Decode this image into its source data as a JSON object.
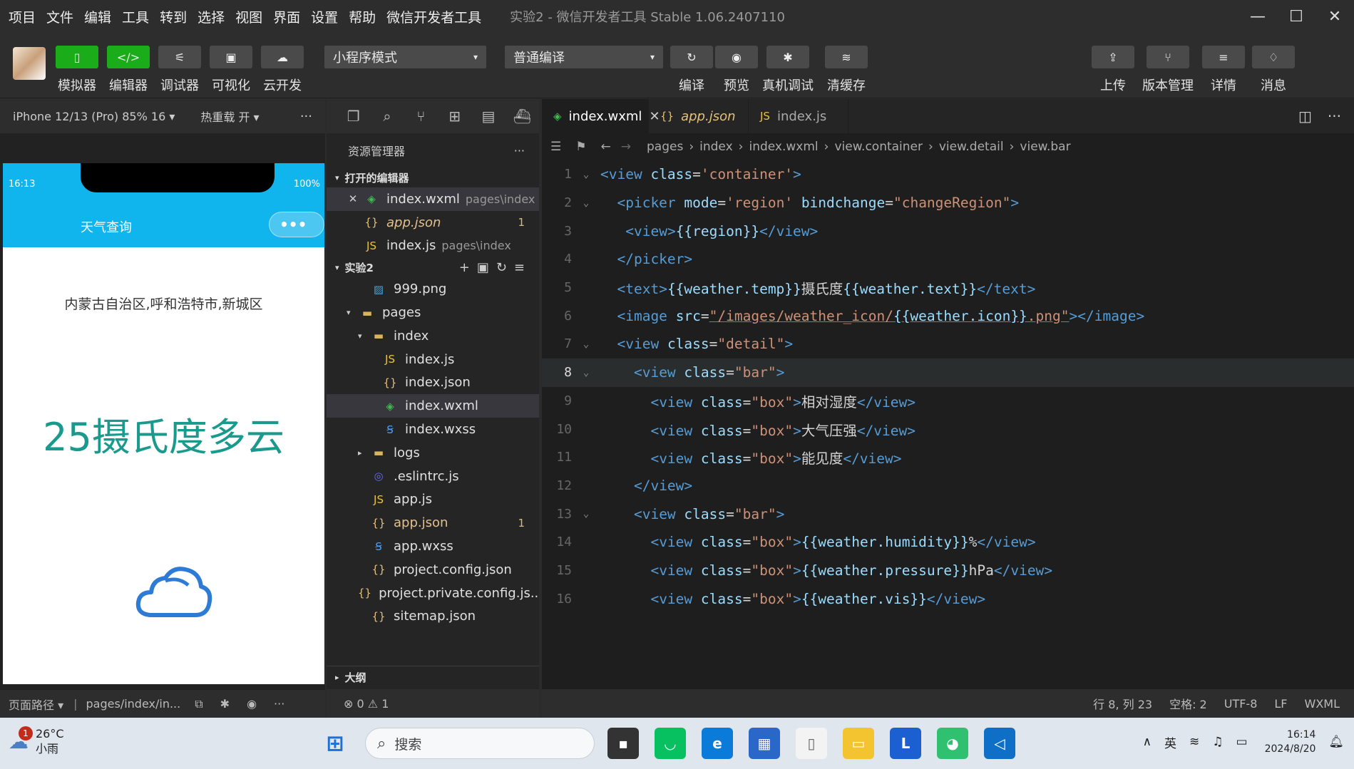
{
  "menu": [
    "项目",
    "文件",
    "编辑",
    "工具",
    "转到",
    "选择",
    "视图",
    "界面",
    "设置",
    "帮助",
    "微信开发者工具"
  ],
  "window_title": "实验2 - 微信开发者工具 Stable 1.06.2407110",
  "toolbar": {
    "left_buttons": [
      {
        "label": "模拟器",
        "icon": "phone-icon",
        "active": true
      },
      {
        "label": "编辑器",
        "icon": "code-icon",
        "active": true
      },
      {
        "label": "调试器",
        "icon": "debug-icon",
        "active": false
      },
      {
        "label": "可视化",
        "icon": "layout-icon",
        "active": false
      },
      {
        "label": "云开发",
        "icon": "cloud-icon",
        "active": false
      }
    ],
    "mode_select": "小程序模式",
    "compile_select": "普通编译",
    "mid_buttons": [
      {
        "label": "编译",
        "icon": "refresh-icon"
      },
      {
        "label": "预览",
        "icon": "eye-icon"
      },
      {
        "label": "真机调试",
        "icon": "bug-icon"
      },
      {
        "label": "清缓存",
        "icon": "layers-icon"
      }
    ],
    "right_buttons": [
      {
        "label": "上传",
        "icon": "upload-icon"
      },
      {
        "label": "版本管理",
        "icon": "branch-icon"
      },
      {
        "label": "详情",
        "icon": "menu-icon"
      },
      {
        "label": "消息",
        "icon": "bell-icon"
      }
    ]
  },
  "simulator": {
    "device": "iPhone 12/13 (Pro) 85% 16 ▾",
    "hot_reload": "热重载 开 ▾",
    "time": "16:13",
    "battery": "100%",
    "nav_title": "天气查询",
    "region": "内蒙古自治区,呼和浩特市,新城区",
    "weather_text": "25摄氏度多云",
    "footer_path_label": "页面路径 ▾",
    "footer_path": "pages/index/in..."
  },
  "explorer": {
    "title": "资源管理器",
    "open_editors_label": "打开的编辑器",
    "open_editors": [
      {
        "name": "index.wxml",
        "sub": "pages\\index",
        "icon": "wxml-icon",
        "closable": true
      },
      {
        "name": "app.json",
        "sub": "",
        "icon": "json-icon",
        "badge": "1",
        "warn": true
      },
      {
        "name": "index.js",
        "sub": "pages\\index",
        "icon": "js-icon"
      }
    ],
    "project_label": "实验2",
    "tree": [
      {
        "name": "999.png",
        "indent": 2,
        "icon": "image-icon"
      },
      {
        "name": "pages",
        "indent": 1,
        "icon": "folder-icon",
        "caret": "▾"
      },
      {
        "name": "index",
        "indent": 2,
        "icon": "folder-icon",
        "caret": "▾"
      },
      {
        "name": "index.js",
        "indent": 3,
        "icon": "js-icon"
      },
      {
        "name": "index.json",
        "indent": 3,
        "icon": "json-icon"
      },
      {
        "name": "index.wxml",
        "indent": 3,
        "icon": "wxml-icon",
        "active": true
      },
      {
        "name": "index.wxss",
        "indent": 3,
        "icon": "wxss-icon"
      },
      {
        "name": "logs",
        "indent": 2,
        "icon": "folder-icon",
        "caret": "▸"
      },
      {
        "name": ".eslintrc.js",
        "indent": 2,
        "icon": "eslint-icon"
      },
      {
        "name": "app.js",
        "indent": 2,
        "icon": "js-icon"
      },
      {
        "name": "app.json",
        "indent": 2,
        "icon": "json-icon",
        "badge": "1",
        "warn": true
      },
      {
        "name": "app.wxss",
        "indent": 2,
        "icon": "wxss-icon"
      },
      {
        "name": "project.config.json",
        "indent": 2,
        "icon": "json-icon"
      },
      {
        "name": "project.private.config.js...",
        "indent": 2,
        "icon": "json-icon"
      },
      {
        "name": "sitemap.json",
        "indent": 2,
        "icon": "json-icon"
      }
    ],
    "outline_label": "大纲",
    "footer": "⊗ 0 ⚠ 1"
  },
  "editor": {
    "tabs": [
      {
        "name": "index.wxml",
        "icon": "wxml-icon",
        "active": true
      },
      {
        "name": "app.json",
        "icon": "json-icon",
        "active": false
      },
      {
        "name": "index.js",
        "icon": "js-icon",
        "active": false
      }
    ],
    "breadcrumb": [
      "pages",
      "index",
      "index.wxml",
      "view.container",
      "view.detail",
      "view.bar"
    ],
    "current_line": 8,
    "lines": [
      "<view class='container'>",
      "  <picker mode='region' bindchange=\"changeRegion\">",
      "   <view>{{region}}</view>",
      "  </picker>",
      "  <text>{{weather.temp}}摄氏度{{weather.text}}</text>",
      "  <image src=\"/images/weather_icon/{{weather.icon}}.png\"></image>",
      "  <view class=\"detail\">",
      "    <view class=\"bar\">",
      "      <view class=\"box\">相对湿度</view>",
      "      <view class=\"box\">大气压强</view>",
      "      <view class=\"box\">能见度</view>",
      "    </view>",
      "    <view class=\"bar\">",
      "      <view class=\"box\">{{weather.humidity}}%</view>",
      "      <view class=\"box\">{{weather.pressure}}hPa</view>",
      "      <view class=\"box\">{{weather.vis}}</view>"
    ],
    "status": {
      "position": "行 8, 列 23",
      "spaces": "空格: 2",
      "encoding": "UTF-8",
      "eol": "LF",
      "language": "WXML"
    }
  },
  "taskbar": {
    "weather_temp": "26°C",
    "weather_desc": "小雨",
    "notif_badge": "1",
    "search_placeholder": "搜索",
    "ime": "英",
    "time": "16:14",
    "date": "2024/8/20"
  }
}
